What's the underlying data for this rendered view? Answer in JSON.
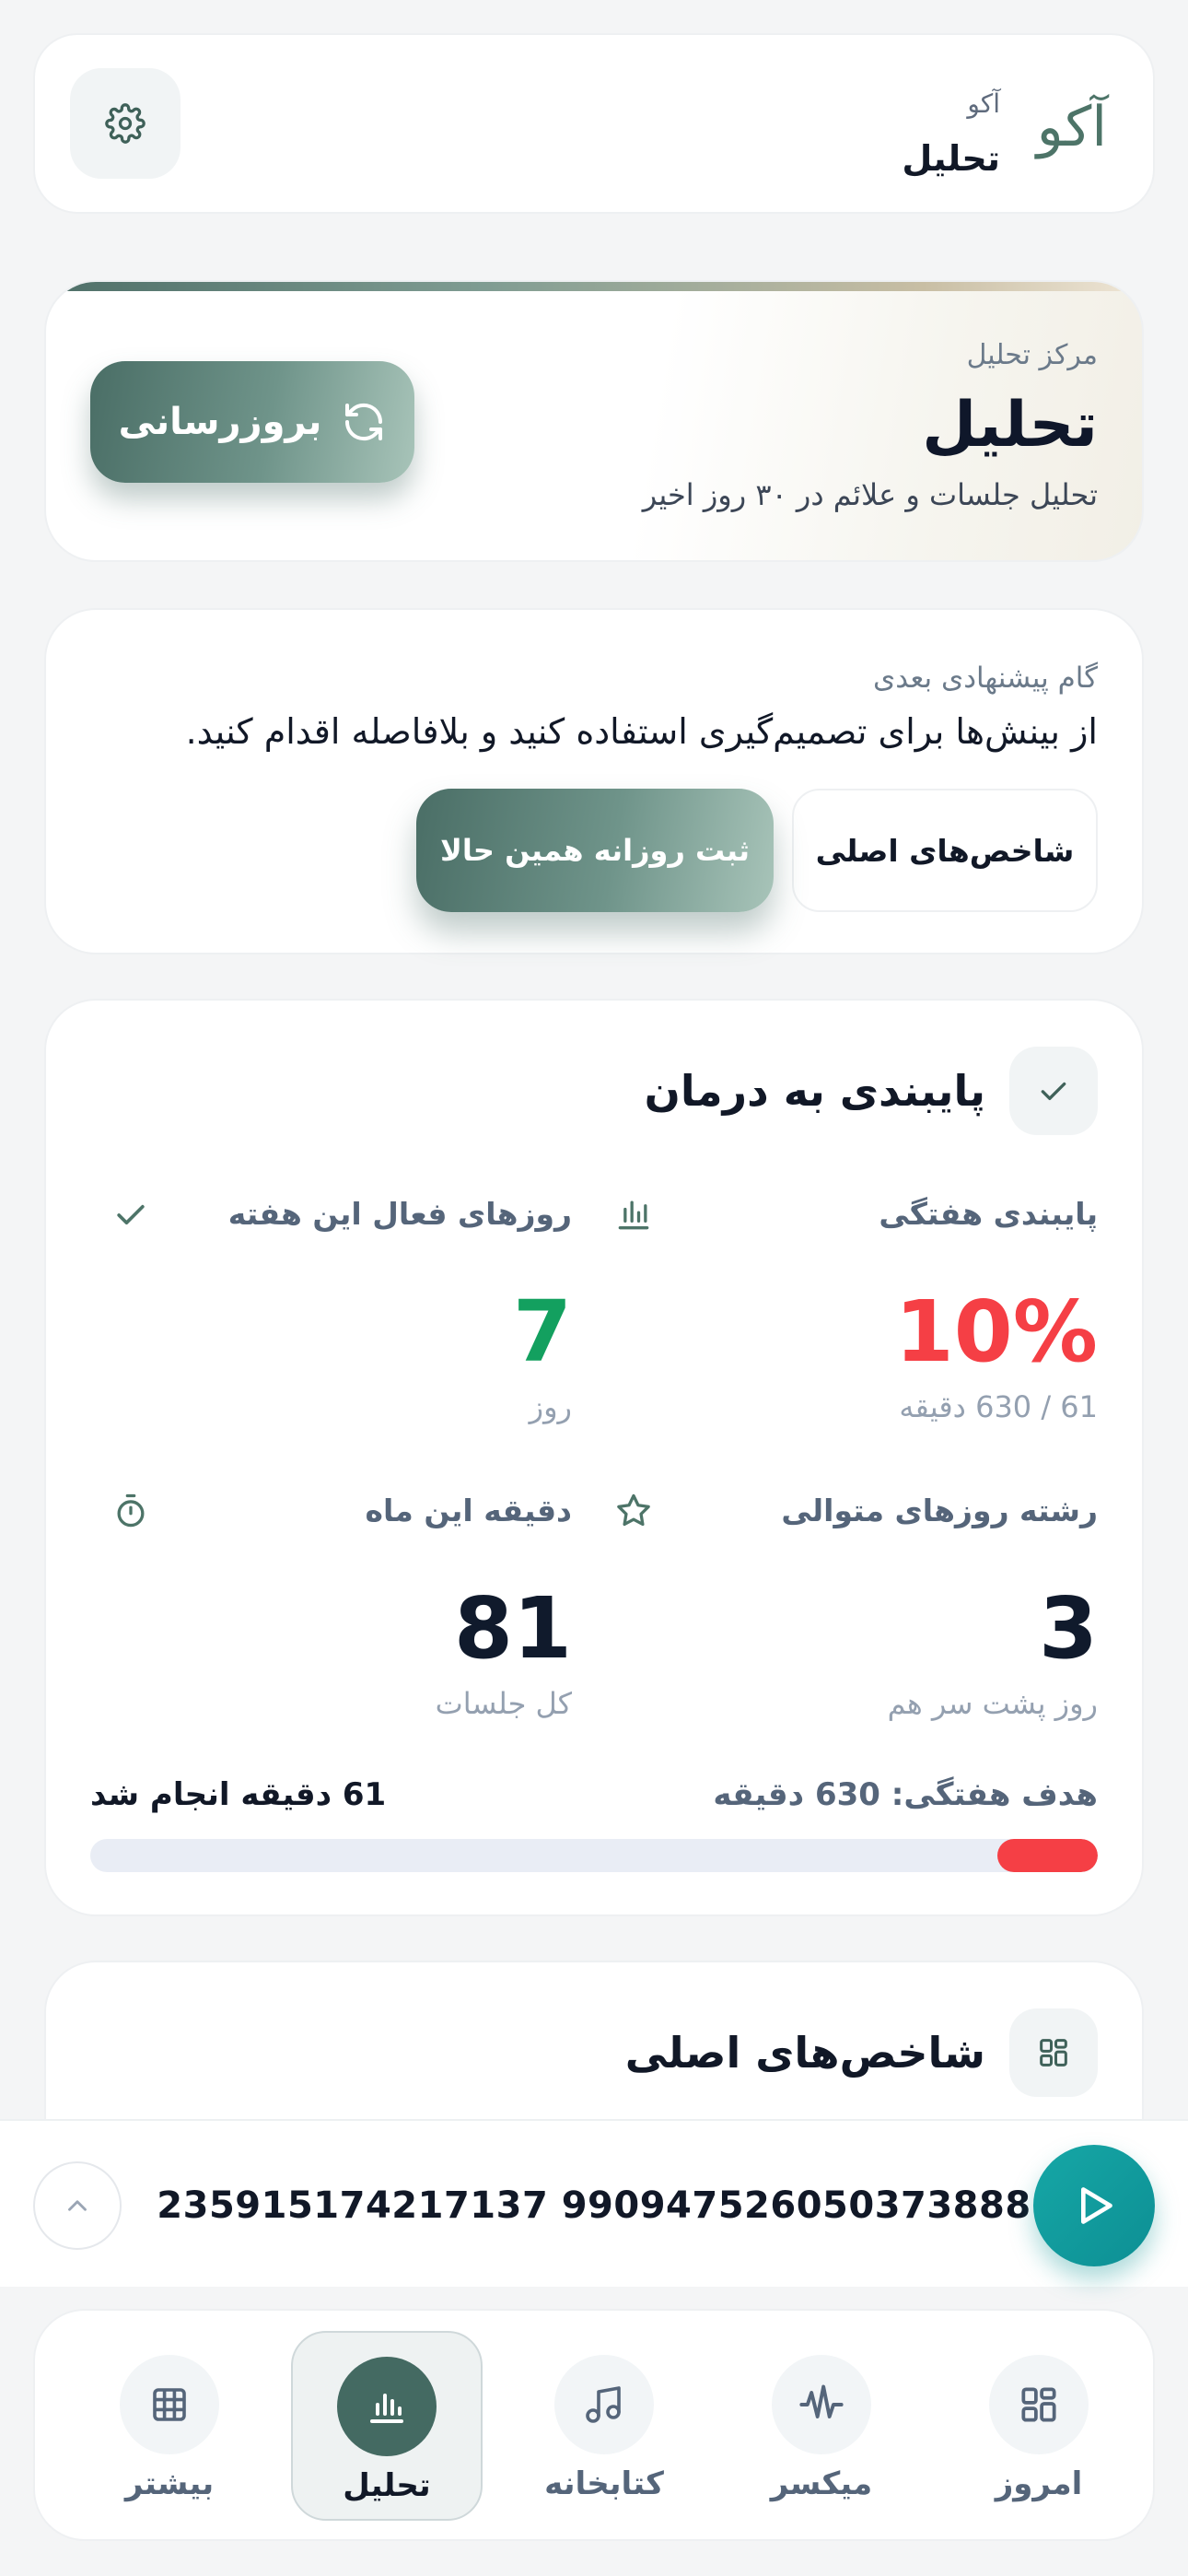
{
  "header": {
    "brand_logo": "آکو",
    "brand_sub": "آکو",
    "title": "تحلیل"
  },
  "hero": {
    "kicker": "مرکز تحلیل",
    "title": "تحلیل",
    "description": "تحلیل جلسات و علائم در ۳۰ روز اخیر",
    "refresh_label": "بروزرسانی"
  },
  "next_step": {
    "kicker": "گام پیشنهادی بعدی",
    "text": "از بینش‌ها برای تصمیم‌گیری استفاده کنید و بلافاصله اقدام کنید.",
    "kpi_button": "شاخص‌های اصلی",
    "journal_button": "ثبت روزانه همین حالا"
  },
  "adherence": {
    "title": "پایبندی به درمان",
    "stats": [
      {
        "label": "پایبندی هفتگی",
        "value": "10%",
        "sub": "61 / 630 دقیقه",
        "color": "#f53f45",
        "icon": "bar-chart-icon"
      },
      {
        "label": "روزهای فعال این هفته",
        "value": "7",
        "sub": "روز",
        "color": "#13a05f",
        "icon": "check-icon"
      },
      {
        "label": "رشته روزهای متوالی",
        "value": "3",
        "sub": "روز پشت سر هم",
        "color": "#101a2c",
        "icon": "star-icon"
      },
      {
        "label": "دقیقه این ماه",
        "value": "81",
        "sub": "کل جلسات",
        "color": "#101a2c",
        "icon": "stopwatch-icon"
      }
    ],
    "goal_label": "هدف هفتگی: 630 دقیقه",
    "done_label": "61 دقیقه انجام شد",
    "progress": 0.1,
    "progress_color": "#f53f45"
  },
  "kpi": {
    "title": "شاخص‌های اصلی"
  },
  "player": {
    "track": "235915174217137 990947526050373888"
  },
  "nav": {
    "items": [
      {
        "label": "امروز",
        "icon": "dashboard-icon"
      },
      {
        "label": "میکسر",
        "icon": "waveform-icon"
      },
      {
        "label": "کتابخانه",
        "icon": "music-note-icon"
      },
      {
        "label": "تحلیل",
        "icon": "analytics-icon",
        "active": true
      },
      {
        "label": "بیشتر",
        "icon": "grid-icon"
      }
    ]
  },
  "colors": {
    "accent": "#446a62",
    "play": "#16a7a6"
  }
}
